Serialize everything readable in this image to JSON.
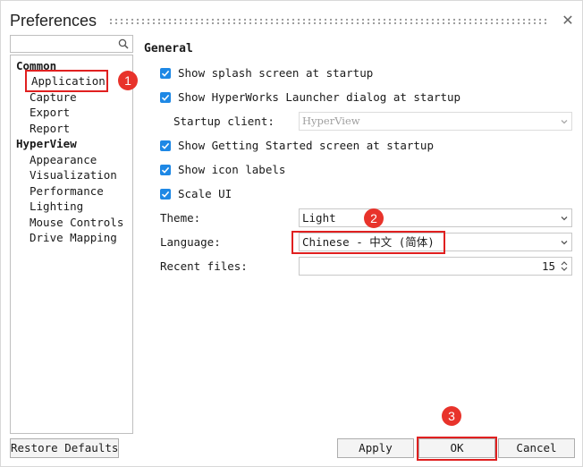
{
  "window": {
    "title": "Preferences",
    "close_glyph": "✕"
  },
  "search": {
    "value": "",
    "placeholder": ""
  },
  "tree": {
    "groups": [
      {
        "label": "Common",
        "items": [
          "Application",
          "Capture",
          "Export",
          "Report"
        ]
      },
      {
        "label": "HyperView",
        "items": [
          "Appearance",
          "Visualization",
          "Performance",
          "Lighting",
          "Mouse Controls",
          "Drive Mapping"
        ]
      }
    ],
    "selected": "Application"
  },
  "general": {
    "title": "General",
    "checks": [
      {
        "label": "Show splash screen at startup",
        "checked": true
      },
      {
        "label": "Show HyperWorks Launcher dialog at startup",
        "checked": true
      },
      {
        "label": "Show Getting Started screen at startup",
        "checked": true
      },
      {
        "label": "Show icon labels",
        "checked": true
      },
      {
        "label": "Scale UI",
        "checked": true
      }
    ],
    "startup_client_label": "Startup client:",
    "startup_client_value": "HyperView",
    "theme_label": "Theme:",
    "theme_value": "Light",
    "language_label": "Language:",
    "language_value": "Chinese - 中文 (简体)",
    "recent_files_label": "Recent files:",
    "recent_files_value": "15"
  },
  "buttons": {
    "restore_defaults": "Restore Defaults",
    "apply": "Apply",
    "ok": "OK",
    "cancel": "Cancel"
  },
  "annotations": {
    "badge_1": "1",
    "badge_2": "2",
    "badge_3": "3",
    "color": "#e02020"
  },
  "colors": {
    "checkbox": "#1e88e5",
    "badge": "#e8332b"
  }
}
